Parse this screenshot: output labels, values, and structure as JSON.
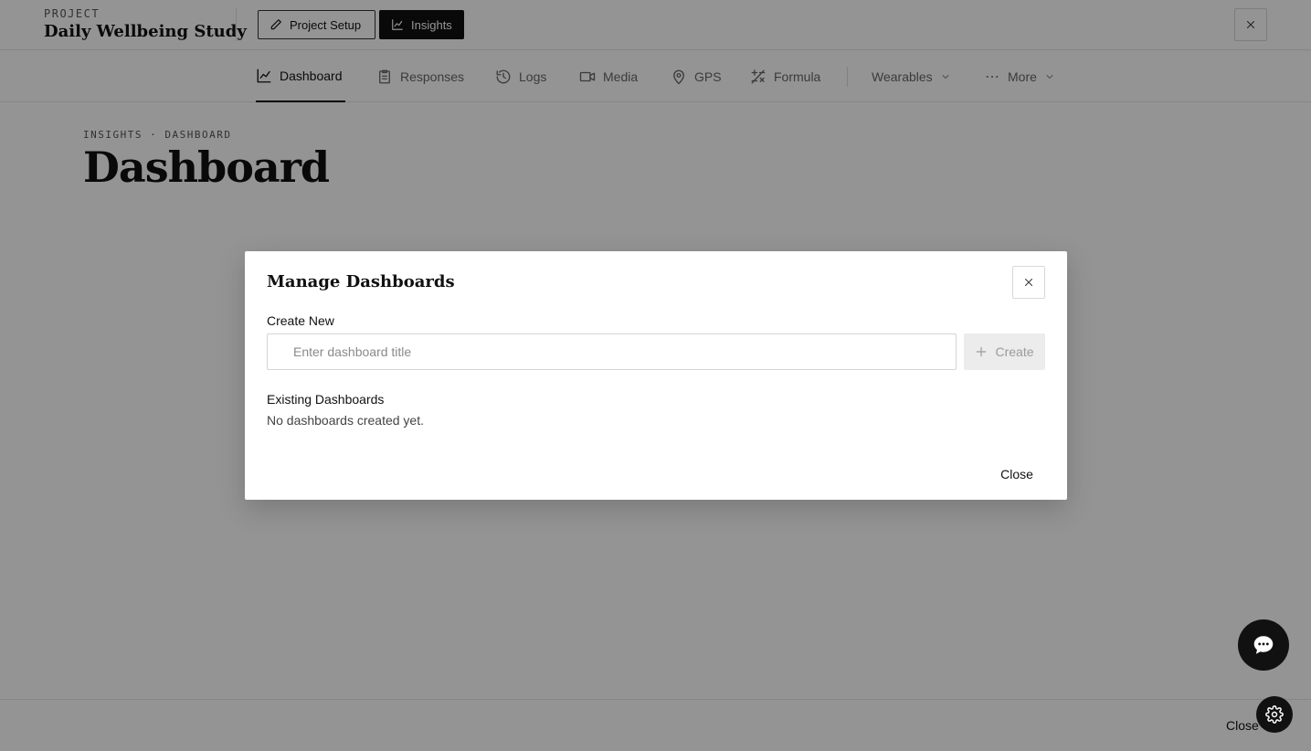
{
  "header": {
    "project_label": "PROJECT",
    "project_title": "Daily Wellbeing Study",
    "project_setup_label": "Project Setup",
    "insights_label": "Insights"
  },
  "nav": {
    "tabs": [
      {
        "label": "Dashboard",
        "icon": "chart-line-icon",
        "active": true
      },
      {
        "label": "Responses",
        "icon": "clipboard-icon"
      },
      {
        "label": "Logs",
        "icon": "history-icon"
      },
      {
        "label": "Media",
        "icon": "video-icon"
      },
      {
        "label": "GPS",
        "icon": "map-pin-icon"
      },
      {
        "label": "Formula",
        "icon": "formula-icon"
      },
      {
        "label": "Wearables",
        "icon": "chevron-down-icon"
      },
      {
        "label": "More",
        "icon": "ellipsis-icon"
      }
    ]
  },
  "page": {
    "breadcrumb": "INSIGHTS · DASHBOARD",
    "title": "Dashboard"
  },
  "footer": {
    "close_label": "Close"
  },
  "modal": {
    "title": "Manage Dashboards",
    "create_label": "Create New",
    "input_placeholder": "Enter dashboard title",
    "input_value": "",
    "create_button": "Create",
    "existing_label": "Existing Dashboards",
    "empty_text": "No dashboards created yet.",
    "close_button": "Close"
  },
  "colors": {
    "accent": "#111111",
    "overlay": "rgba(0,0,0,0.42)",
    "disabled_bg": "#ececec"
  }
}
